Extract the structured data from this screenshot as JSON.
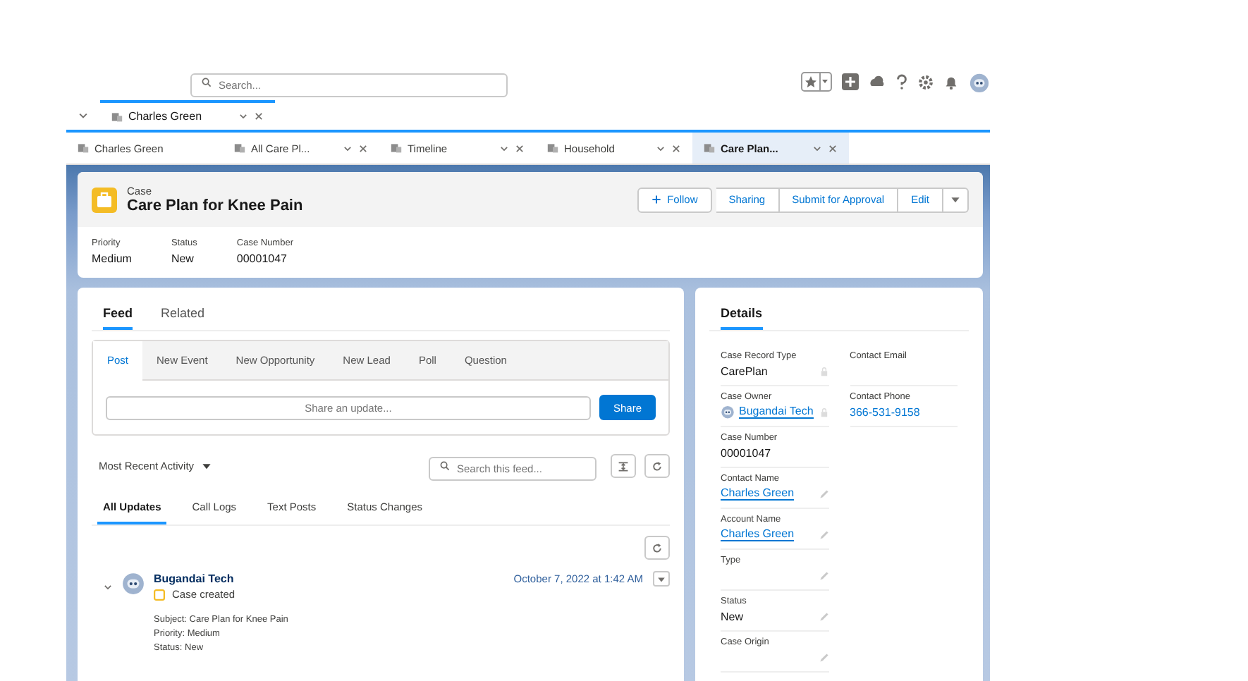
{
  "header": {
    "search": {
      "placeholder": "Search..."
    }
  },
  "workspace_tabs": [
    {
      "label": "Charles Green",
      "selected": true
    }
  ],
  "subtabs": [
    {
      "label": "Charles Green",
      "selected": false,
      "closable": false
    },
    {
      "label": "All Care Pl...",
      "selected": false,
      "closable": true
    },
    {
      "label": "Timeline",
      "selected": false,
      "closable": true
    },
    {
      "label": "Household",
      "selected": false,
      "closable": true
    },
    {
      "label": "Care Plan...",
      "selected": true,
      "closable": true
    }
  ],
  "record": {
    "object": "Case",
    "title": "Care Plan for Knee Pain",
    "actions": [
      "Follow",
      "Sharing",
      "Submit for Approval",
      "Edit"
    ],
    "highlights": [
      {
        "label": "Priority",
        "value": "Medium"
      },
      {
        "label": "Status",
        "value": "New"
      },
      {
        "label": "Case Number",
        "value": "00001047"
      }
    ]
  },
  "feed_panel": {
    "tabs": [
      {
        "label": "Feed",
        "selected": true
      },
      {
        "label": "Related",
        "selected": false
      }
    ],
    "publisher_tabs": [
      {
        "label": "Post",
        "selected": true
      },
      {
        "label": "New Event",
        "selected": false
      },
      {
        "label": "New Opportunity",
        "selected": false
      },
      {
        "label": "New Lead",
        "selected": false
      },
      {
        "label": "Poll",
        "selected": false
      },
      {
        "label": "Question",
        "selected": false
      }
    ],
    "share_placeholder": "Share an update...",
    "share_button": "Share",
    "sort": "Most Recent Activity",
    "feed_search_placeholder": "Search this feed...",
    "filters": [
      {
        "label": "All Updates",
        "selected": true
      },
      {
        "label": "Call Logs",
        "selected": false
      },
      {
        "label": "Text Posts",
        "selected": false
      },
      {
        "label": "Status Changes",
        "selected": false
      }
    ],
    "posts": [
      {
        "author": "Bugandai Tech",
        "event": "Case created",
        "timestamp": "October 7, 2022 at 1:42 AM",
        "lines": [
          "Subject: Care Plan for Knee Pain",
          "Priority: Medium",
          "Status: New"
        ]
      }
    ]
  },
  "details": {
    "title": "Details",
    "columns": [
      [
        {
          "label": "Case Record Type",
          "value": "CarePlan",
          "kind": "text",
          "editable": false,
          "locked": true
        },
        {
          "label": "Case Owner",
          "value": "Bugandai Tech",
          "kind": "owner",
          "editable": false,
          "locked": true
        },
        {
          "label": "Case Number",
          "value": "00001047",
          "kind": "text",
          "editable": false,
          "locked": false
        },
        {
          "label": "Contact Name",
          "value": "Charles Green",
          "kind": "link",
          "editable": true,
          "locked": false
        },
        {
          "label": "Account Name",
          "value": "Charles Green",
          "kind": "link",
          "editable": true,
          "locked": false
        },
        {
          "label": "Type",
          "kind": "text",
          "editable": true,
          "locked": false
        },
        {
          "label": "Status",
          "value": "New",
          "kind": "text",
          "editable": true,
          "locked": false
        },
        {
          "label": "Case Origin",
          "kind": "text",
          "editable": true,
          "locked": false
        }
      ],
      [
        {
          "label": "Contact Email",
          "kind": "text",
          "editable": false,
          "locked": false
        },
        {
          "label": "Contact Phone",
          "value": "366-531-9158",
          "kind": "phone",
          "editable": false,
          "locked": false
        }
      ]
    ]
  }
}
